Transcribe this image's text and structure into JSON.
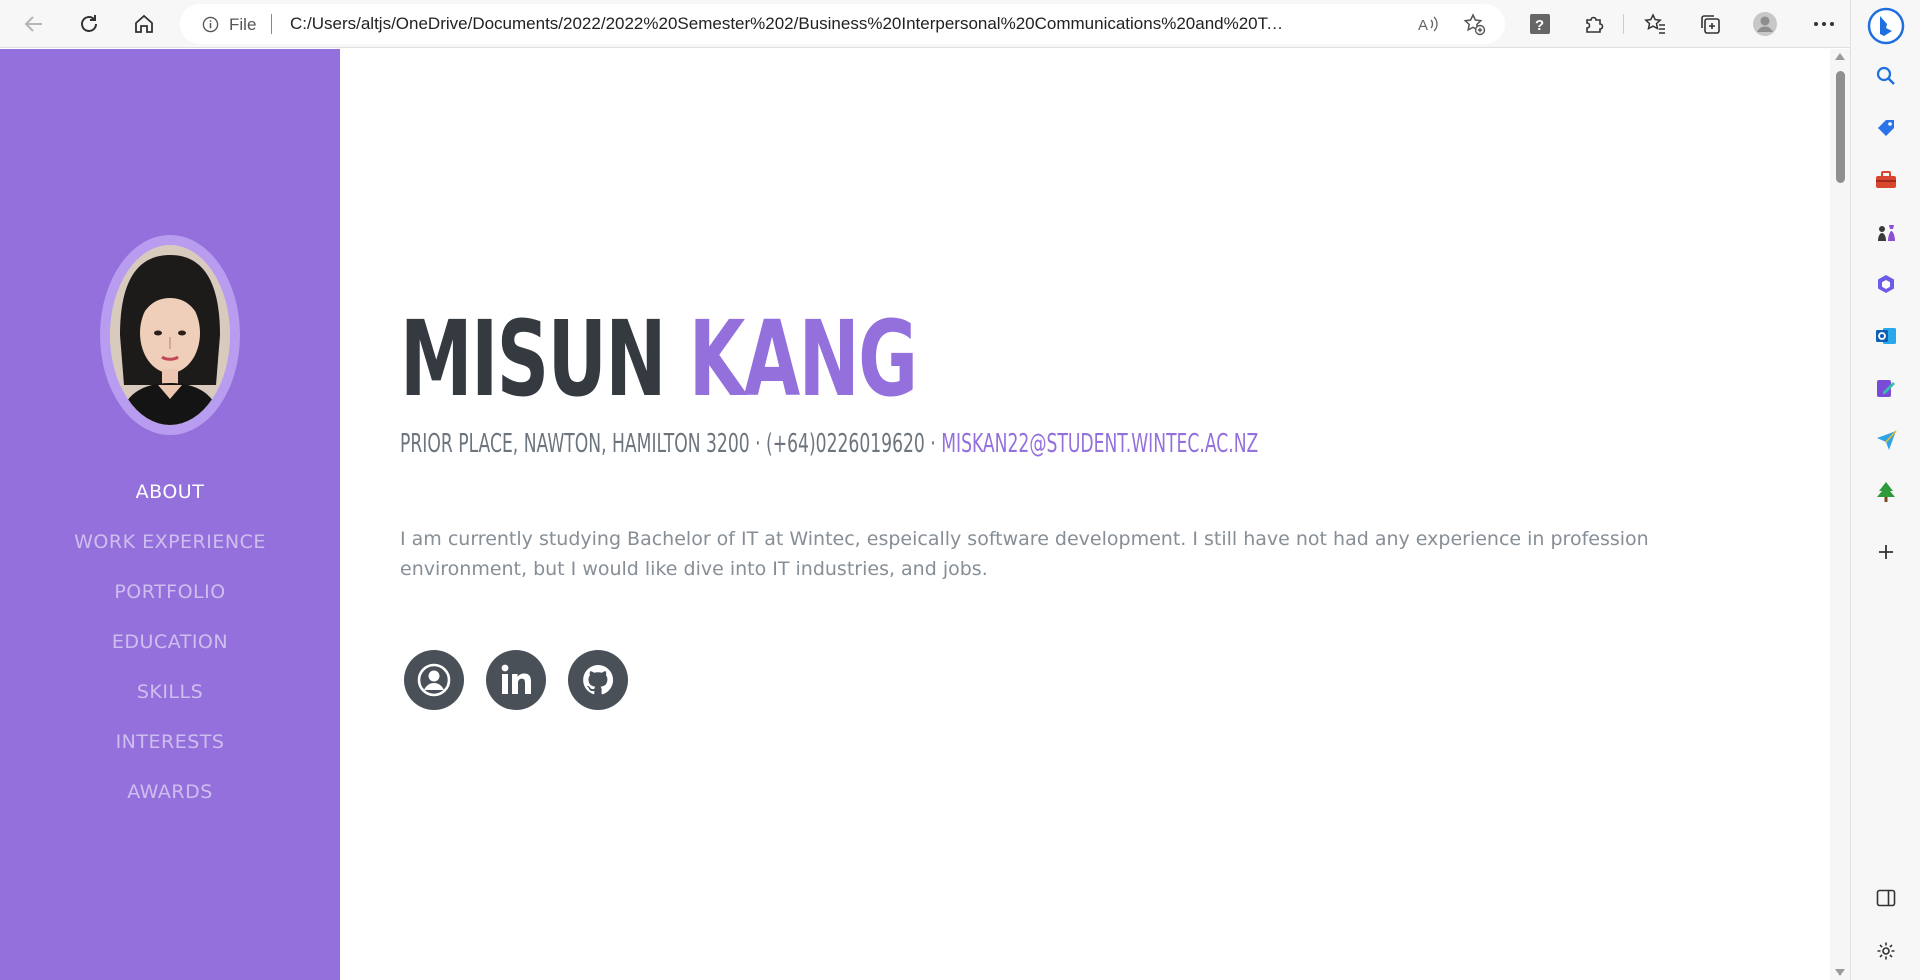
{
  "browser": {
    "address_prefix": "File",
    "url": "C:/Users/altjs/OneDrive/Documents/2022/2022%20Semester%202/Business%20Interpersonal%20Communications%20and%20Technical..."
  },
  "profile": {
    "first_name": "MISUN",
    "last_name": "KANG",
    "address_phone": "PRIOR PLACE, NAWTON, HAMILTON 3200 · (+64)0226019620 · ",
    "email": "MISKAN22@STUDENT.WINTEC.AC.NZ",
    "bio": "I am currently studying Bachelor of IT at Wintec, espeically software development. I still have not had any experience in profession environment, but I would like dive into IT industries, and jobs."
  },
  "nav": {
    "items": [
      {
        "label": "ABOUT"
      },
      {
        "label": "WORK EXPERIENCE"
      },
      {
        "label": "PORTFOLIO"
      },
      {
        "label": "EDUCATION"
      },
      {
        "label": "SKILLS"
      },
      {
        "label": "INTERESTS"
      },
      {
        "label": "AWARDS"
      }
    ],
    "active_index": 0
  },
  "social": [
    "user-circle-icon",
    "linkedin-icon",
    "github-icon"
  ],
  "colors": {
    "primary": "#9370db",
    "dark": "#343a40",
    "muted": "#868e96",
    "social_bg": "#495057"
  }
}
